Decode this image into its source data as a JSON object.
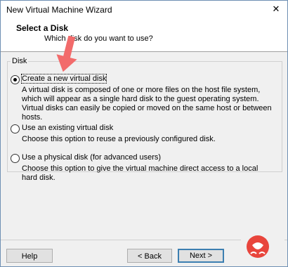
{
  "window": {
    "title": "New Virtual Machine Wizard",
    "close_label": "✕"
  },
  "header": {
    "title": "Select a Disk",
    "subtitle": "Which disk do you want to use?"
  },
  "disk_group": {
    "legend": "Disk",
    "options": [
      {
        "label": "Create a new virtual disk",
        "description": "A virtual disk is composed of one or more files on the host file system, which will appear as a single hard disk to the guest operating system. Virtual disks can easily be copied or moved on the same host or between hosts.",
        "selected": true
      },
      {
        "label": "Use an existing virtual disk",
        "description": "Choose this option to reuse a previously configured disk.",
        "selected": false
      },
      {
        "label": "Use a physical disk (for advanced users)",
        "description": "Choose this option to give the virtual machine direct access to a local hard disk.",
        "selected": false
      }
    ]
  },
  "buttons": {
    "help": "Help",
    "back": "< Back",
    "next": "Next >"
  },
  "colors": {
    "arrow": "#f26b6b",
    "accent": "#3c7fb1",
    "logo": "#e8453c"
  }
}
